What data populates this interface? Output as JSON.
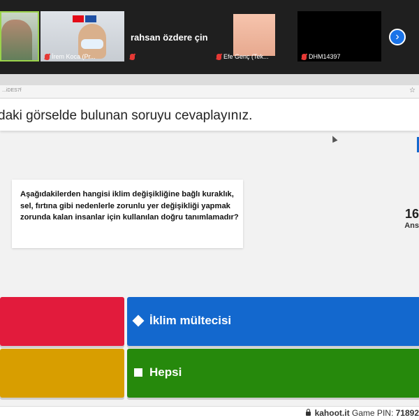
{
  "meeting": {
    "participants": [
      {
        "name": ""
      },
      {
        "name": "İrem Koca (Pr..."
      },
      {
        "name": "rahsan özdere çin"
      },
      {
        "name": "Efe Genç (Tek..."
      },
      {
        "name": "DHM14397"
      }
    ],
    "next_icon": "chevron-right-icon"
  },
  "browser": {
    "url_fragment": "...iDES7f"
  },
  "kahoot": {
    "instruction": "daki görselde bulunan soruyu cevaplayınız.",
    "question_image_text": "Aşağıdakilerden hangisi iklim değişikliğine bağlı kuraklık, sel, fırtına gibi nedenlerle zorunlu yer değişikliği yapmak zorunda kalan insanlar için kullanılan doğru tanımlamadır?",
    "answer_count": "16",
    "answer_count_label": "Ans",
    "answers": [
      {
        "shape": "triangle",
        "label": "",
        "color": "#e21b3c"
      },
      {
        "shape": "diamond",
        "label": "İklim mültecisi",
        "color": "#1368ce"
      },
      {
        "shape": "circle",
        "label": "",
        "color": "#d89e00"
      },
      {
        "shape": "square",
        "label": "Hepsi",
        "color": "#26890c"
      }
    ],
    "footer_site": "kahoot.it",
    "footer_pin_label": "Game PIN:",
    "footer_pin": "71892"
  }
}
